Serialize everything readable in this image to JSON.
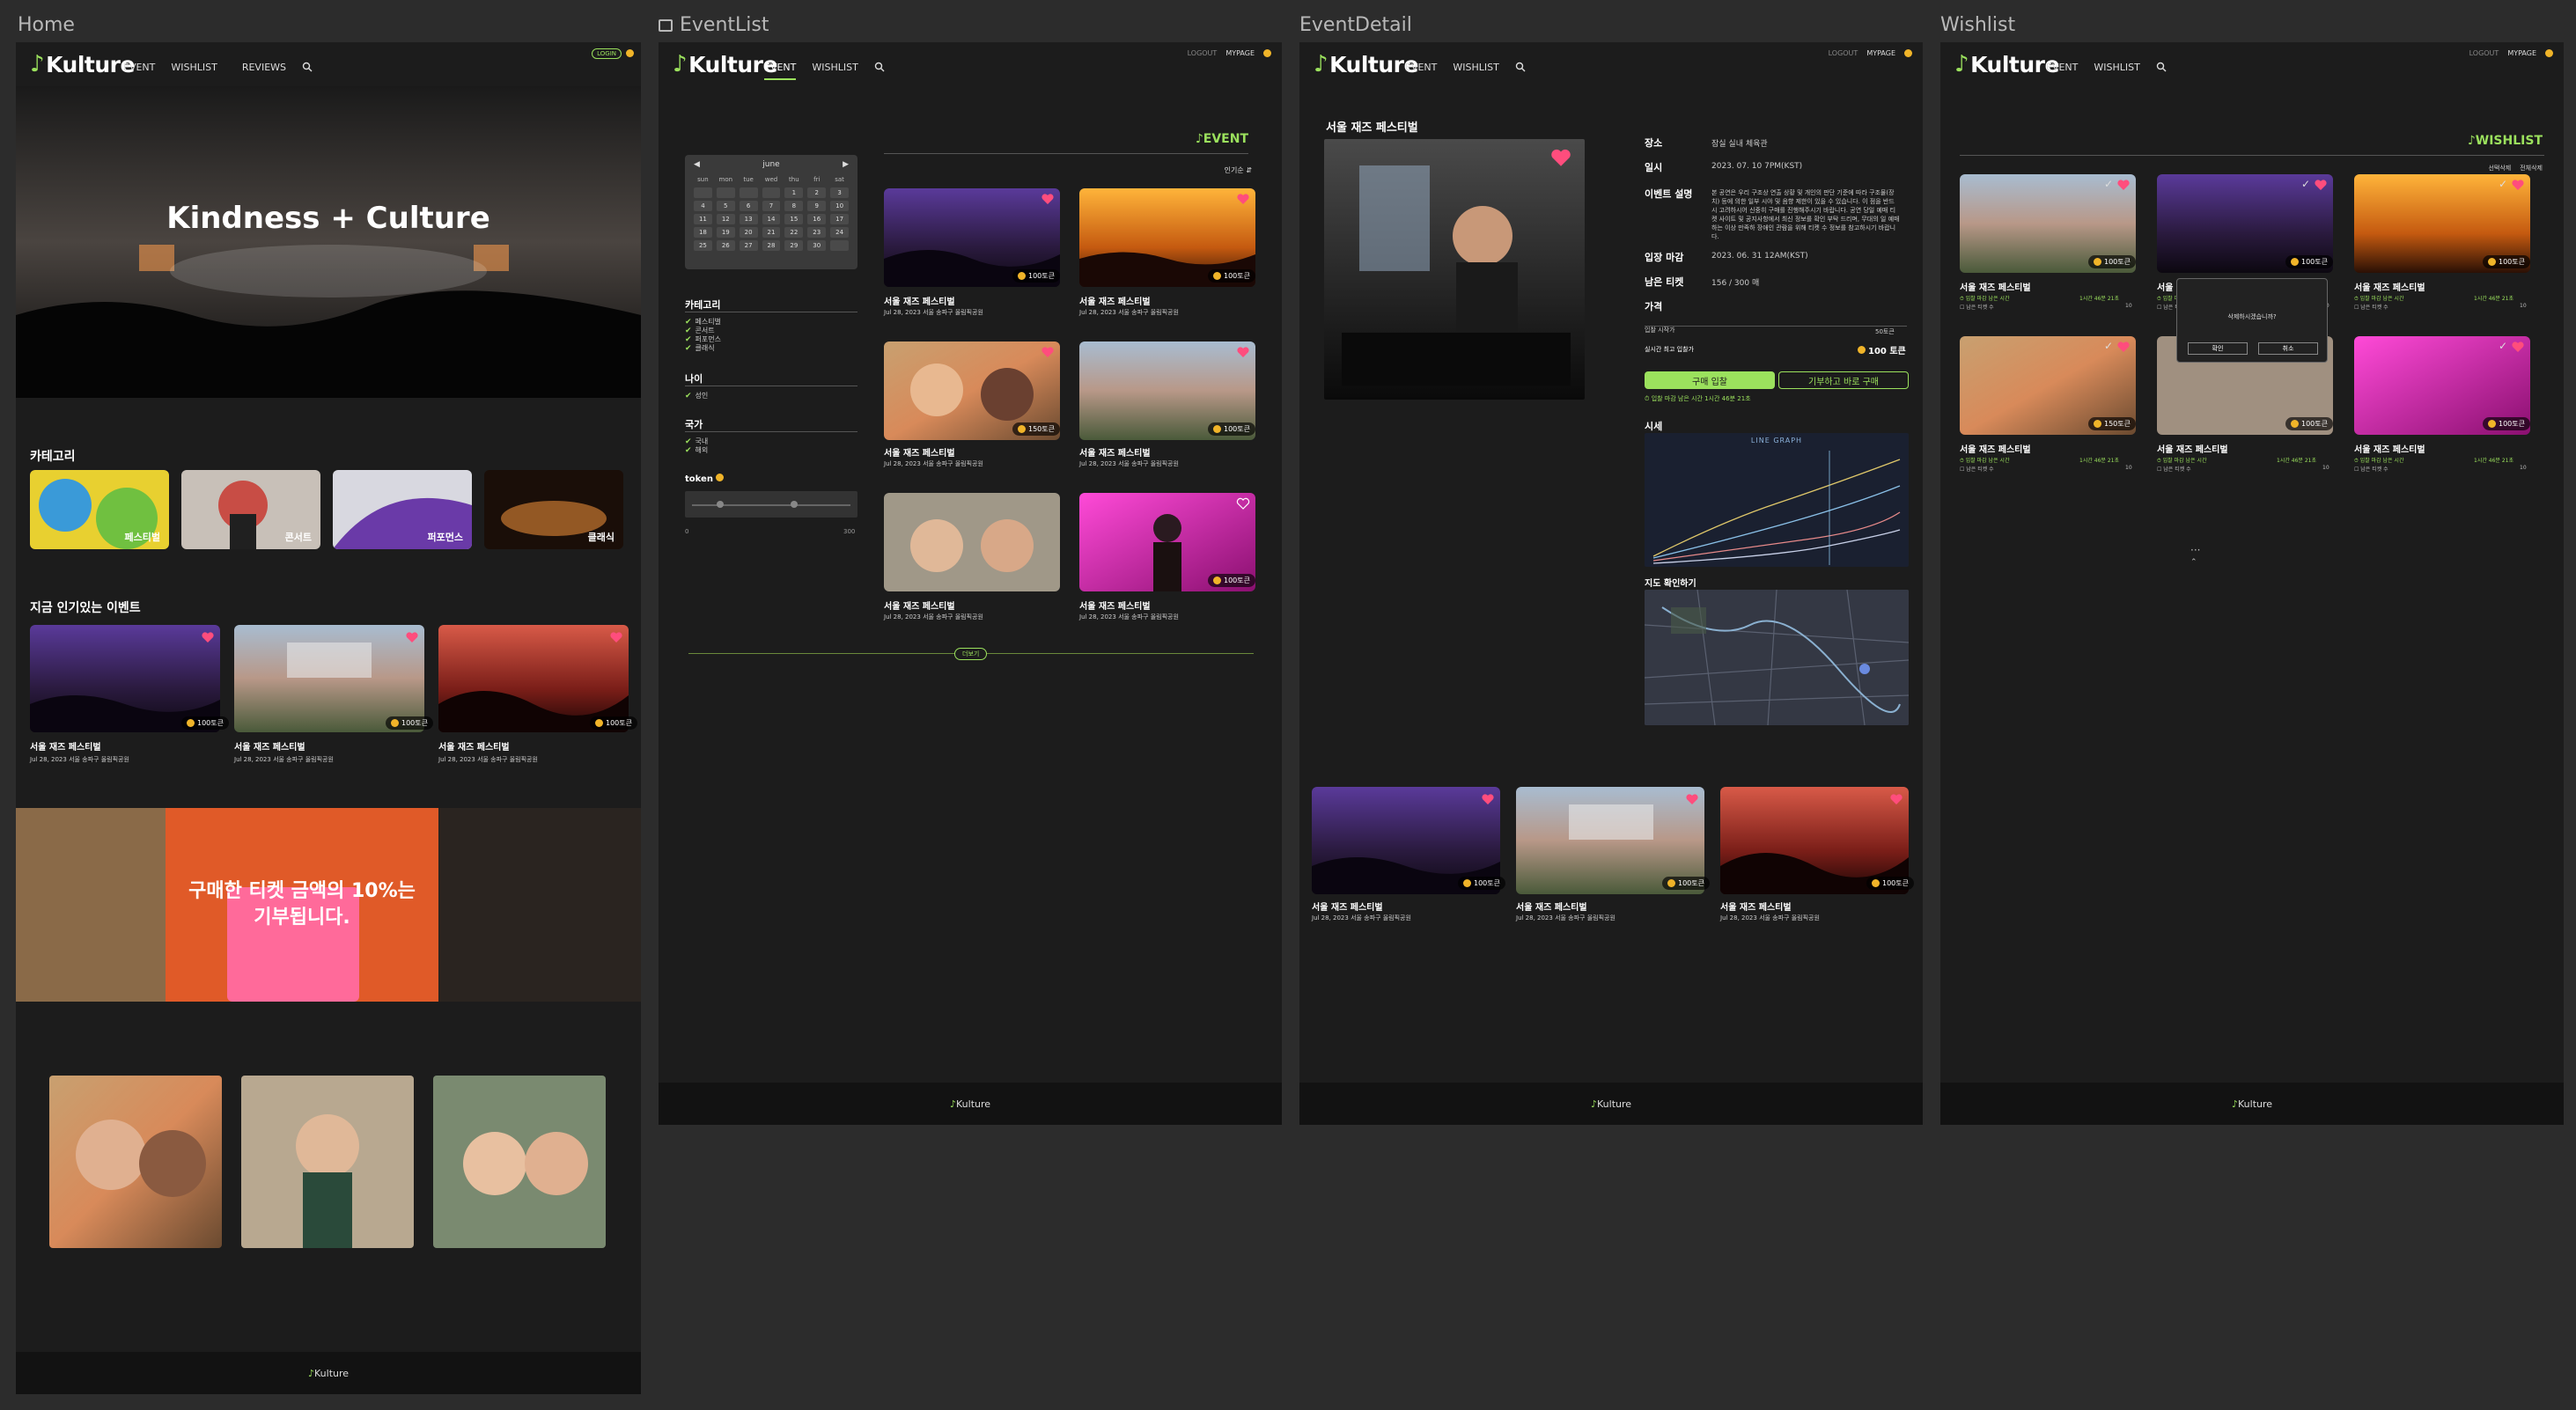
{
  "brand": {
    "logo_note": "♪",
    "logo_text": "Kulture",
    "footer_text": "Kulture"
  },
  "nav": {
    "event": "EVENT",
    "wishlist": "WISHLIST",
    "reviews": "REVIEWS",
    "login": "LOGIN",
    "logout": "LOGOUT",
    "mypage": "MYPAGE"
  },
  "frames": {
    "home": "Home",
    "eventlist": "EventList",
    "eventdetail": "EventDetail",
    "wishlist": "Wishlist"
  },
  "home": {
    "hero_title": "Kindness + Culture",
    "category_title": "카테고리",
    "categories": [
      "페스티벌",
      "콘서트",
      "퍼포먼스",
      "클래식"
    ],
    "popular_title": "지금 인기있는 이벤트",
    "banner_text_1": "구매한 티켓 금액의 10%는",
    "banner_text_2": "기부됩니다."
  },
  "event": {
    "title": "서울 재즈 페스티벌",
    "date_place": "Jul 28, 2023 서울 송파구 올림픽공원",
    "price": "100토큰",
    "price_alt": "150토큰"
  },
  "eventlist": {
    "heading": "EVENT",
    "sort": "인기순",
    "cal_month": "june",
    "cal_weekdays": [
      "sun",
      "mon",
      "tue",
      "wed",
      "thu",
      "fri",
      "sat"
    ],
    "cal_days": [
      "",
      "",
      "",
      "",
      "1",
      "2",
      "3",
      "4",
      "5",
      "6",
      "7",
      "8",
      "9",
      "10",
      "11",
      "12",
      "13",
      "14",
      "15",
      "16",
      "17",
      "18",
      "19",
      "20",
      "21",
      "22",
      "23",
      "24",
      "25",
      "26",
      "27",
      "28",
      "29",
      "30",
      ""
    ],
    "filter_category": "카테고리",
    "filter_category_items": [
      "페스티벌",
      "콘서트",
      "퍼포먼스",
      "클래식"
    ],
    "filter_age": "나이",
    "filter_age_items": [
      "성인"
    ],
    "filter_country": "국가",
    "filter_country_items": [
      "국내",
      "해외"
    ],
    "filter_token": "token",
    "range_min": "0",
    "range_max": "300",
    "more": "더보기"
  },
  "detail": {
    "title": "서울 재즈 페스티벌",
    "place_label": "장소",
    "place": "잠실 실내 체육관",
    "date_label": "일시",
    "date": "2023. 07. 10  7PM(KST)",
    "desc_label": "이벤트 설명",
    "desc": "본 공연은 우리 구조상 연출 상황 및 개인의 판단 기준에 따라 구조물(장치) 등에 의한 일부 시야 및 음향 제한이 있을 수 있습니다. 이 점을 반드시 고려하시어 신중히 구매를 진행해주시기 바랍니다. 공연 당일 예매 티켓 사이트 및 공지사항에서 최신 정보를 확인 부탁 드리며, 무대의 일 예매하는 이상 만족하 장애인 관람을 위해 티켓 수 정보를 참고하시기 바랍니다.",
    "deadline_label": "입장 마감",
    "deadline": "2023. 06. 31  12AM(KST)",
    "remain_label": "남은 티켓",
    "remain": "156 / 300 매",
    "price_label": "가격",
    "start_price": "입찰 시작가",
    "start_val": "50토큰",
    "current_price": "실시간 최고 입찰가",
    "current_val": "100 토큰",
    "bid_button": "구매 입찰",
    "donate_button": "기부하고 바로 구매",
    "time_left": "입찰 마감 남은 시간    1시간 46분 21초",
    "market_label": "시세",
    "graph_title": "LINE GRAPH",
    "map_label": "지도 확인하기"
  },
  "wishlist": {
    "heading": "WISHLIST",
    "select_delete": "선택삭제",
    "delete_all": "전체삭제",
    "time_left": "입찰 마감 남은 시간",
    "time_val": "1시간 46분 21초",
    "remain": "남은 티켓 수",
    "remain_val": "10",
    "dialog_text": "삭제하시겠습니까?",
    "confirm": "확인",
    "cancel": "취소",
    "more": "···"
  },
  "colors": {
    "accent": "#9be15d",
    "bg": "#1c1c1c",
    "coin": "#f0b429",
    "heart": "#ff4d7d"
  }
}
